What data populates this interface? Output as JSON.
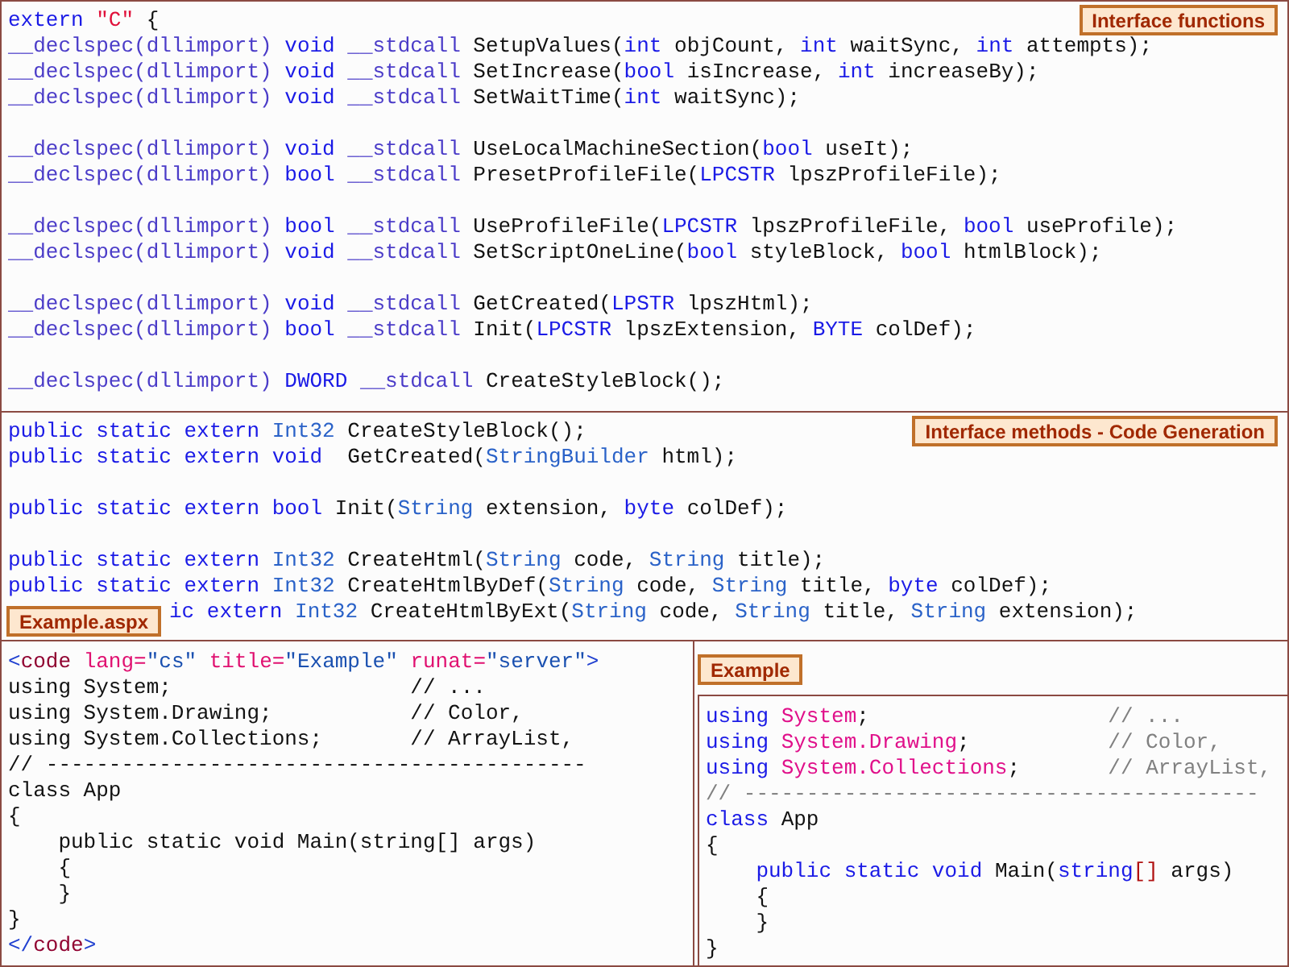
{
  "panels": [
    {
      "label": "Interface functions",
      "blocks": [
        [
          [
            {
              "kind": "keyword",
              "text": "extern "
            },
            {
              "kind": "string",
              "text": "\"C\""
            },
            {
              "kind": "plain",
              "text": " {"
            }
          ],
          [
            {
              "kind": "decl",
              "text": "__declspec(dllimport) "
            },
            {
              "kind": "keyword",
              "text": "void "
            },
            {
              "kind": "decl",
              "text": "__stdcall "
            },
            {
              "kind": "plain",
              "text": "SetupValues("
            },
            {
              "kind": "keyword",
              "text": "int "
            },
            {
              "kind": "plain",
              "text": "objCount, "
            },
            {
              "kind": "keyword",
              "text": "int "
            },
            {
              "kind": "plain",
              "text": "waitSync, "
            },
            {
              "kind": "keyword",
              "text": "int "
            },
            {
              "kind": "plain",
              "text": "attempts);"
            }
          ],
          [
            {
              "kind": "decl",
              "text": "__declspec(dllimport) "
            },
            {
              "kind": "keyword",
              "text": "void "
            },
            {
              "kind": "decl",
              "text": "__stdcall "
            },
            {
              "kind": "plain",
              "text": "SetIncrease("
            },
            {
              "kind": "keyword",
              "text": "bool "
            },
            {
              "kind": "plain",
              "text": "isIncrease, "
            },
            {
              "kind": "keyword",
              "text": "int "
            },
            {
              "kind": "plain",
              "text": "increaseBy);"
            }
          ],
          [
            {
              "kind": "decl",
              "text": "__declspec(dllimport) "
            },
            {
              "kind": "keyword",
              "text": "void "
            },
            {
              "kind": "decl",
              "text": "__stdcall "
            },
            {
              "kind": "plain",
              "text": "SetWaitTime("
            },
            {
              "kind": "keyword",
              "text": "int "
            },
            {
              "kind": "plain",
              "text": "waitSync);"
            }
          ]
        ],
        [
          [
            {
              "kind": "decl",
              "text": "__declspec(dllimport) "
            },
            {
              "kind": "keyword",
              "text": "void "
            },
            {
              "kind": "decl",
              "text": "__stdcall "
            },
            {
              "kind": "plain",
              "text": "UseLocalMachineSection("
            },
            {
              "kind": "keyword",
              "text": "bool "
            },
            {
              "kind": "plain",
              "text": "useIt);"
            }
          ],
          [
            {
              "kind": "decl",
              "text": "__declspec(dllimport) "
            },
            {
              "kind": "keyword",
              "text": "bool "
            },
            {
              "kind": "decl",
              "text": "__stdcall "
            },
            {
              "kind": "plain",
              "text": "PresetProfileFile("
            },
            {
              "kind": "keyword",
              "text": "LPCSTR "
            },
            {
              "kind": "plain",
              "text": "lpszProfileFile);"
            }
          ]
        ],
        [
          [
            {
              "kind": "decl",
              "text": "__declspec(dllimport) "
            },
            {
              "kind": "keyword",
              "text": "bool "
            },
            {
              "kind": "decl",
              "text": "__stdcall "
            },
            {
              "kind": "plain",
              "text": "UseProfileFile("
            },
            {
              "kind": "keyword",
              "text": "LPCSTR "
            },
            {
              "kind": "plain",
              "text": "lpszProfileFile, "
            },
            {
              "kind": "keyword",
              "text": "bool "
            },
            {
              "kind": "plain",
              "text": "useProfile);"
            }
          ],
          [
            {
              "kind": "decl",
              "text": "__declspec(dllimport) "
            },
            {
              "kind": "keyword",
              "text": "void "
            },
            {
              "kind": "decl",
              "text": "__stdcall "
            },
            {
              "kind": "plain",
              "text": "SetScriptOneLine("
            },
            {
              "kind": "keyword",
              "text": "bool "
            },
            {
              "kind": "plain",
              "text": "styleBlock, "
            },
            {
              "kind": "keyword",
              "text": "bool "
            },
            {
              "kind": "plain",
              "text": "htmlBlock);"
            }
          ]
        ],
        [
          [
            {
              "kind": "decl",
              "text": "__declspec(dllimport) "
            },
            {
              "kind": "keyword",
              "text": "void "
            },
            {
              "kind": "decl",
              "text": "__stdcall "
            },
            {
              "kind": "plain",
              "text": "GetCreated("
            },
            {
              "kind": "keyword",
              "text": "LPSTR "
            },
            {
              "kind": "plain",
              "text": "lpszHtml);"
            }
          ],
          [
            {
              "kind": "decl",
              "text": "__declspec(dllimport) "
            },
            {
              "kind": "keyword",
              "text": "bool "
            },
            {
              "kind": "decl",
              "text": "__stdcall "
            },
            {
              "kind": "plain",
              "text": "Init("
            },
            {
              "kind": "keyword",
              "text": "LPCSTR "
            },
            {
              "kind": "plain",
              "text": "lpszExtension, "
            },
            {
              "kind": "keyword",
              "text": "BYTE "
            },
            {
              "kind": "plain",
              "text": "colDef);"
            }
          ]
        ],
        [
          [
            {
              "kind": "decl",
              "text": "__declspec(dllimport) "
            },
            {
              "kind": "keyword",
              "text": "DWORD "
            },
            {
              "kind": "decl",
              "text": "__stdcall "
            },
            {
              "kind": "plain",
              "text": "CreateStyleBlock();"
            }
          ]
        ]
      ]
    },
    {
      "label": "Interface methods - Code Generation",
      "blocks": [
        [
          [
            {
              "kind": "keyword",
              "text": "public static extern "
            },
            {
              "kind": "type",
              "text": "Int32 "
            },
            {
              "kind": "plain",
              "text": "CreateStyleBlock();"
            }
          ],
          [
            {
              "kind": "keyword",
              "text": "public static extern "
            },
            {
              "kind": "keyword",
              "text": "void  "
            },
            {
              "kind": "plain",
              "text": "GetCreated("
            },
            {
              "kind": "type",
              "text": "StringBuilder "
            },
            {
              "kind": "plain",
              "text": "html);"
            }
          ]
        ],
        [
          [
            {
              "kind": "keyword",
              "text": "public static extern "
            },
            {
              "kind": "keyword",
              "text": "bool "
            },
            {
              "kind": "plain",
              "text": "Init("
            },
            {
              "kind": "type",
              "text": "String "
            },
            {
              "kind": "plain",
              "text": "extension, "
            },
            {
              "kind": "keyword",
              "text": "byte "
            },
            {
              "kind": "plain",
              "text": "colDef);"
            }
          ]
        ],
        [
          [
            {
              "kind": "keyword",
              "text": "public static extern "
            },
            {
              "kind": "type",
              "text": "Int32 "
            },
            {
              "kind": "plain",
              "text": "CreateHtml("
            },
            {
              "kind": "type",
              "text": "String "
            },
            {
              "kind": "plain",
              "text": "code, "
            },
            {
              "kind": "type",
              "text": "String "
            },
            {
              "kind": "plain",
              "text": "title);"
            }
          ],
          [
            {
              "kind": "keyword",
              "text": "public static extern "
            },
            {
              "kind": "type",
              "text": "Int32 "
            },
            {
              "kind": "plain",
              "text": "CreateHtmlByDef("
            },
            {
              "kind": "type",
              "text": "String "
            },
            {
              "kind": "plain",
              "text": "code, "
            },
            {
              "kind": "type",
              "text": "String "
            },
            {
              "kind": "plain",
              "text": "title, "
            },
            {
              "kind": "keyword",
              "text": "byte "
            },
            {
              "kind": "plain",
              "text": "colDef);"
            }
          ],
          [
            {
              "kind": "keyword",
              "text": "ic extern "
            },
            {
              "kind": "type",
              "text": "Int32 "
            },
            {
              "kind": "plain",
              "text": "CreateHtmlByExt("
            },
            {
              "kind": "type",
              "text": "String "
            },
            {
              "kind": "plain",
              "text": "code, "
            },
            {
              "kind": "type",
              "text": "String "
            },
            {
              "kind": "plain",
              "text": "title, "
            },
            {
              "kind": "type",
              "text": "String "
            },
            {
              "kind": "plain",
              "text": "extension);"
            }
          ]
        ]
      ]
    },
    {
      "label": "Example.aspx",
      "blocks": [
        [
          [
            {
              "kind": "bracket",
              "text": "<"
            },
            {
              "kind": "tag",
              "text": "code "
            },
            {
              "kind": "attr",
              "text": "lang="
            },
            {
              "kind": "attrvalue",
              "text": "\"cs\" "
            },
            {
              "kind": "attr",
              "text": "title="
            },
            {
              "kind": "attrvalue",
              "text": "\"Example\" "
            },
            {
              "kind": "attr",
              "text": "runat="
            },
            {
              "kind": "attrvalue",
              "text": "\"server\""
            },
            {
              "kind": "bracket",
              "text": ">"
            }
          ],
          [
            {
              "kind": "plain",
              "text": "using System;                   // ..."
            }
          ],
          [
            {
              "kind": "plain",
              "text": "using System.Drawing;           // Color,"
            }
          ],
          [
            {
              "kind": "plain",
              "text": "using System.Collections;       // ArrayList,"
            }
          ],
          [
            {
              "kind": "plain",
              "text": "// -------------------------------------------"
            }
          ],
          [
            {
              "kind": "plain",
              "text": "class App"
            }
          ],
          [
            {
              "kind": "plain",
              "text": "{"
            }
          ],
          [
            {
              "kind": "plain",
              "text": "    public static void Main(string[] args)"
            }
          ],
          [
            {
              "kind": "plain",
              "text": "    {"
            }
          ],
          [
            {
              "kind": "plain",
              "text": "    }"
            }
          ],
          [
            {
              "kind": "plain",
              "text": "}"
            }
          ],
          [
            {
              "kind": "bracket",
              "text": "</"
            },
            {
              "kind": "tag",
              "text": "code"
            },
            {
              "kind": "bracket",
              "text": ">"
            }
          ]
        ]
      ]
    }
  ],
  "example": {
    "label": "Example",
    "lines": [
      [
        {
          "kind": "keyword",
          "text": "using "
        },
        {
          "kind": "ident",
          "text": "System"
        },
        {
          "kind": "plain",
          "text": ";                   "
        },
        {
          "kind": "comment",
          "text": "// ..."
        }
      ],
      [
        {
          "kind": "keyword",
          "text": "using "
        },
        {
          "kind": "ident",
          "text": "System.Drawing"
        },
        {
          "kind": "plain",
          "text": ";           "
        },
        {
          "kind": "comment",
          "text": "// Color,"
        }
      ],
      [
        {
          "kind": "keyword",
          "text": "using "
        },
        {
          "kind": "ident",
          "text": "System.Collections"
        },
        {
          "kind": "plain",
          "text": ";       "
        },
        {
          "kind": "comment",
          "text": "// ArrayList,"
        }
      ],
      [
        {
          "kind": "comment",
          "text": "// -----------------------------------------"
        }
      ],
      [
        {
          "kind": "keyword",
          "text": "class "
        },
        {
          "kind": "plain",
          "text": "App"
        }
      ],
      [
        {
          "kind": "plain",
          "text": "{"
        }
      ],
      [
        {
          "kind": "keyword",
          "text": "    public static void "
        },
        {
          "kind": "plain",
          "text": "Main("
        },
        {
          "kind": "keyword",
          "text": "string"
        },
        {
          "kind": "ident2",
          "text": "[]"
        },
        {
          "kind": "plain",
          "text": " args)"
        }
      ],
      [
        {
          "kind": "plain",
          "text": "    {"
        }
      ],
      [
        {
          "kind": "plain",
          "text": "    }"
        }
      ],
      [
        {
          "kind": "plain",
          "text": "}"
        }
      ]
    ]
  }
}
